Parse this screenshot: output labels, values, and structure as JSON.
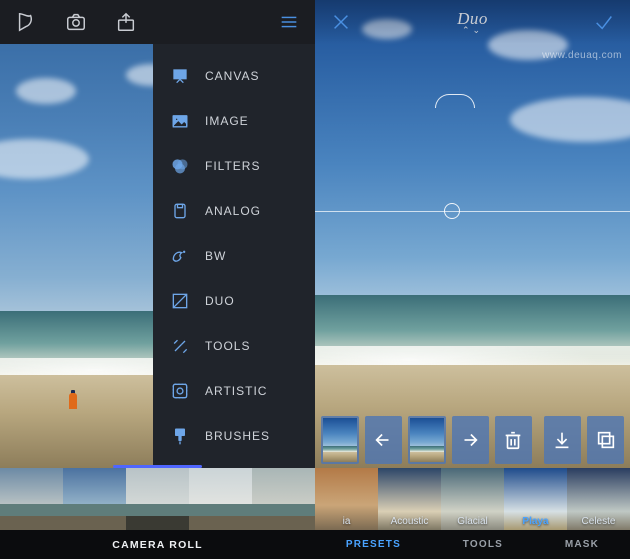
{
  "left": {
    "menu": {
      "items": [
        {
          "label": "CANVAS",
          "icon": "canvas-icon"
        },
        {
          "label": "IMAGE",
          "icon": "image-icon"
        },
        {
          "label": "FILTERS",
          "icon": "filters-icon"
        },
        {
          "label": "ANALOG",
          "icon": "analog-icon"
        },
        {
          "label": "BW",
          "icon": "bw-icon"
        },
        {
          "label": "DUO",
          "icon": "duo-icon"
        },
        {
          "label": "TOOLS",
          "icon": "tools-icon"
        },
        {
          "label": "ARTISTIC",
          "icon": "artistic-icon"
        },
        {
          "label": "BRUSHES",
          "icon": "brushes-icon"
        }
      ]
    },
    "bottom_label": "CAMERA ROLL"
  },
  "right": {
    "title": "Duo",
    "presets": [
      {
        "label": "ia",
        "selected": false
      },
      {
        "label": "Acoustic",
        "selected": false
      },
      {
        "label": "Glacial",
        "selected": false
      },
      {
        "label": "Playa",
        "selected": true
      },
      {
        "label": "Celeste",
        "selected": false
      }
    ],
    "tabs": [
      {
        "label": "PRESETS",
        "active": true
      },
      {
        "label": "TOOLS",
        "active": false
      },
      {
        "label": "MASK",
        "active": false
      }
    ]
  },
  "watermark": "www.deuaq.com"
}
